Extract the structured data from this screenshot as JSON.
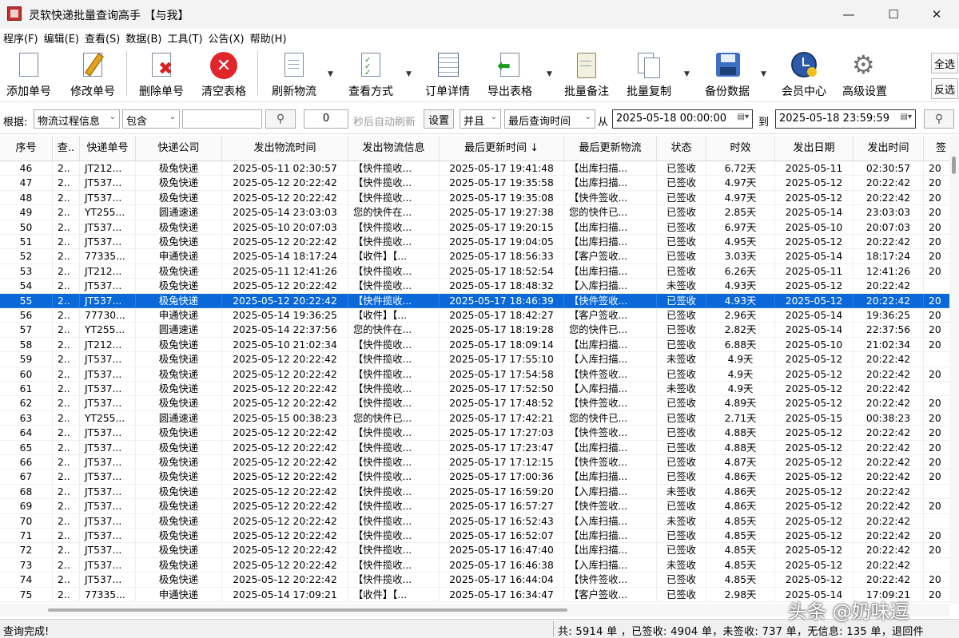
{
  "window": {
    "title": "灵软快递批量查询高手 【与我】"
  },
  "menu": [
    "程序(F)",
    "编辑(E)",
    "查看(S)",
    "数据(B)",
    "工具(T)",
    "公告(X)",
    "帮助(H)"
  ],
  "toolbar": {
    "add": "添加单号",
    "edit": "修改单号",
    "delete": "删除单号",
    "clear": "清空表格",
    "refresh": "刷新物流",
    "view": "查看方式",
    "detail": "订单详情",
    "export": "导出表格",
    "note": "批量备注",
    "copy": "批量复制",
    "backup": "备份数据",
    "member": "会员中心",
    "settings": "高级设置",
    "select_all": "全选",
    "invert": "反选"
  },
  "filter": {
    "basis_label": "根据:",
    "field": "物流过程信息",
    "mode": "包含",
    "keyword": "",
    "seconds": "0",
    "auto_label": "秒后自动刷新",
    "set": "设置",
    "logic": "并且",
    "time_field": "最后查询时间",
    "from_label": "从",
    "from": "2025-05-18 00:00:00",
    "to_label": "到",
    "to": "2025-05-18 23:59:59"
  },
  "columns": [
    "序号",
    "查..",
    "快递单号",
    "快递公司",
    "发出物流时间",
    "发出物流信息",
    "最后更新时间 ↓",
    "最后更新物流",
    "状态",
    "时效",
    "发出日期",
    "发出时间",
    "签"
  ],
  "rows": [
    [
      "46",
      "2..",
      "JT212...",
      "极兔快递",
      "2025-05-11 02:30:57",
      "【快件揽收...",
      "2025-05-17 19:41:48",
      "【出库扫描...",
      "已签收",
      "6.72天",
      "2025-05-11",
      "02:30:57",
      "20"
    ],
    [
      "47",
      "2..",
      "JT537...",
      "极兔快递",
      "2025-05-12 20:22:42",
      "【快件揽收...",
      "2025-05-17 19:35:58",
      "【出库扫描...",
      "已签收",
      "4.97天",
      "2025-05-12",
      "20:22:42",
      "20"
    ],
    [
      "48",
      "2..",
      "JT537...",
      "极兔快递",
      "2025-05-12 20:22:42",
      "【快件揽收...",
      "2025-05-17 19:35:08",
      "【快件签收...",
      "已签收",
      "4.97天",
      "2025-05-12",
      "20:22:42",
      "20"
    ],
    [
      "49",
      "2..",
      "YT255...",
      "圆通速递",
      "2025-05-14 23:03:03",
      "您的快件在...",
      "2025-05-17 19:27:38",
      "您的快件已...",
      "已签收",
      "2.85天",
      "2025-05-14",
      "23:03:03",
      "20"
    ],
    [
      "50",
      "2..",
      "JT537...",
      "极兔快递",
      "2025-05-10 20:07:03",
      "【快件揽收...",
      "2025-05-17 19:20:15",
      "【出库扫描...",
      "已签收",
      "6.97天",
      "2025-05-10",
      "20:07:03",
      "20"
    ],
    [
      "51",
      "2..",
      "JT537...",
      "极兔快递",
      "2025-05-12 20:22:42",
      "【快件揽收...",
      "2025-05-17 19:04:05",
      "【出库扫描...",
      "已签收",
      "4.95天",
      "2025-05-12",
      "20:22:42",
      "20"
    ],
    [
      "52",
      "2..",
      "77335...",
      "申通快递",
      "2025-05-14 18:17:24",
      "【收件】【...",
      "2025-05-17 18:56:33",
      "【客户签收...",
      "已签收",
      "3.03天",
      "2025-05-14",
      "18:17:24",
      "20"
    ],
    [
      "53",
      "2..",
      "JT212...",
      "极兔快递",
      "2025-05-11 12:41:26",
      "【快件揽收...",
      "2025-05-17 18:52:54",
      "【出库扫描...",
      "已签收",
      "6.26天",
      "2025-05-11",
      "12:41:26",
      "20"
    ],
    [
      "54",
      "2..",
      "JT537...",
      "极兔快递",
      "2025-05-12 20:22:42",
      "【快件揽收...",
      "2025-05-17 18:48:32",
      "【入库扫描...",
      "未签收",
      "4.93天",
      "2025-05-12",
      "20:22:42",
      ""
    ],
    [
      "55",
      "2..",
      "JT537...",
      "极兔快递",
      "2025-05-12 20:22:42",
      "【快件揽收...",
      "2025-05-17 18:46:39",
      "【快件签收...",
      "已签收",
      "4.93天",
      "2025-05-12",
      "20:22:42",
      "20"
    ],
    [
      "56",
      "2..",
      "77730...",
      "申通快递",
      "2025-05-14 19:36:25",
      "【收件】【...",
      "2025-05-17 18:42:27",
      "【客户签收...",
      "已签收",
      "2.96天",
      "2025-05-14",
      "19:36:25",
      "20"
    ],
    [
      "57",
      "2..",
      "YT255...",
      "圆通速递",
      "2025-05-14 22:37:56",
      "您的快件在...",
      "2025-05-17 18:19:28",
      "您的快件已...",
      "已签收",
      "2.82天",
      "2025-05-14",
      "22:37:56",
      "20"
    ],
    [
      "58",
      "2..",
      "JT212...",
      "极兔快递",
      "2025-05-10 21:02:34",
      "【快件揽收...",
      "2025-05-17 18:09:14",
      "【出库扫描...",
      "已签收",
      "6.88天",
      "2025-05-10",
      "21:02:34",
      "20"
    ],
    [
      "59",
      "2..",
      "JT537...",
      "极兔快递",
      "2025-05-12 20:22:42",
      "【快件揽收...",
      "2025-05-17 17:55:10",
      "【入库扫描...",
      "未签收",
      "4.9天",
      "2025-05-12",
      "20:22:42",
      ""
    ],
    [
      "60",
      "2..",
      "JT537...",
      "极兔快递",
      "2025-05-12 20:22:42",
      "【快件揽收...",
      "2025-05-17 17:54:58",
      "【快件签收...",
      "已签收",
      "4.9天",
      "2025-05-12",
      "20:22:42",
      "20"
    ],
    [
      "61",
      "2..",
      "JT537...",
      "极兔快递",
      "2025-05-12 20:22:42",
      "【快件揽收...",
      "2025-05-17 17:52:50",
      "【入库扫描...",
      "未签收",
      "4.9天",
      "2025-05-12",
      "20:22:42",
      ""
    ],
    [
      "62",
      "2..",
      "JT537...",
      "极兔快递",
      "2025-05-12 20:22:42",
      "【快件揽收...",
      "2025-05-17 17:48:52",
      "【快件签收...",
      "已签收",
      "4.89天",
      "2025-05-12",
      "20:22:42",
      "20"
    ],
    [
      "63",
      "2..",
      "YT255...",
      "圆通速递",
      "2025-05-15 00:38:23",
      "您的快件已...",
      "2025-05-17 17:42:21",
      "您的快件已...",
      "已签收",
      "2.71天",
      "2025-05-15",
      "00:38:23",
      "20"
    ],
    [
      "64",
      "2..",
      "JT537...",
      "极兔快递",
      "2025-05-12 20:22:42",
      "【快件揽收...",
      "2025-05-17 17:27:03",
      "【快件签收...",
      "已签收",
      "4.88天",
      "2025-05-12",
      "20:22:42",
      "20"
    ],
    [
      "65",
      "2..",
      "JT537...",
      "极兔快递",
      "2025-05-12 20:22:42",
      "【快件揽收...",
      "2025-05-17 17:23:47",
      "【出库扫描...",
      "已签收",
      "4.88天",
      "2025-05-12",
      "20:22:42",
      "20"
    ],
    [
      "66",
      "2..",
      "JT537...",
      "极兔快递",
      "2025-05-12 20:22:42",
      "【快件揽收...",
      "2025-05-17 17:12:15",
      "【快件签收...",
      "已签收",
      "4.87天",
      "2025-05-12",
      "20:22:42",
      "20"
    ],
    [
      "67",
      "2..",
      "JT537...",
      "极兔快递",
      "2025-05-12 20:22:42",
      "【快件揽收...",
      "2025-05-17 17:00:36",
      "【出库扫描...",
      "已签收",
      "4.86天",
      "2025-05-12",
      "20:22:42",
      "20"
    ],
    [
      "68",
      "2..",
      "JT537...",
      "极兔快递",
      "2025-05-12 20:22:42",
      "【快件揽收...",
      "2025-05-17 16:59:20",
      "【入库扫描...",
      "未签收",
      "4.86天",
      "2025-05-12",
      "20:22:42",
      ""
    ],
    [
      "69",
      "2..",
      "JT537...",
      "极兔快递",
      "2025-05-12 20:22:42",
      "【快件揽收...",
      "2025-05-17 16:57:27",
      "【快件签收...",
      "已签收",
      "4.86天",
      "2025-05-12",
      "20:22:42",
      "20"
    ],
    [
      "70",
      "2..",
      "JT537...",
      "极兔快递",
      "2025-05-12 20:22:42",
      "【快件揽收...",
      "2025-05-17 16:52:43",
      "【入库扫描...",
      "未签收",
      "4.85天",
      "2025-05-12",
      "20:22:42",
      ""
    ],
    [
      "71",
      "2..",
      "JT537...",
      "极兔快递",
      "2025-05-12 20:22:42",
      "【快件揽收...",
      "2025-05-17 16:52:07",
      "【出库扫描...",
      "已签收",
      "4.85天",
      "2025-05-12",
      "20:22:42",
      "20"
    ],
    [
      "72",
      "2..",
      "JT537...",
      "极兔快递",
      "2025-05-12 20:22:42",
      "【快件揽收...",
      "2025-05-17 16:47:40",
      "【出库扫描...",
      "已签收",
      "4.85天",
      "2025-05-12",
      "20:22:42",
      "20"
    ],
    [
      "73",
      "2..",
      "JT537...",
      "极兔快递",
      "2025-05-12 20:22:42",
      "【快件揽收...",
      "2025-05-17 16:46:38",
      "【入库扫描...",
      "未签收",
      "4.85天",
      "2025-05-12",
      "20:22:42",
      ""
    ],
    [
      "74",
      "2..",
      "JT537...",
      "极兔快递",
      "2025-05-12 20:22:42",
      "【快件揽收...",
      "2025-05-17 16:44:04",
      "【快件签收...",
      "已签收",
      "4.85天",
      "2025-05-12",
      "20:22:42",
      "20"
    ],
    [
      "75",
      "2..",
      "77335...",
      "申通快递",
      "2025-05-14 17:09:21",
      "【收件】【...",
      "2025-05-17 16:34:47",
      "【客户签收...",
      "已签收",
      "2.98天",
      "2025-05-14",
      "17:09:21",
      "20"
    ]
  ],
  "selected_row": "55",
  "status": {
    "left": "查询完成!",
    "right": "共: 5914 单 ，已签收:  4904 单，未签收:  737 单，无信息: 135 单，退回件"
  },
  "watermark": "头条 @奶味逗",
  "colors": {
    "selection": "#0a68d8",
    "accent_red": "#e0262b"
  }
}
